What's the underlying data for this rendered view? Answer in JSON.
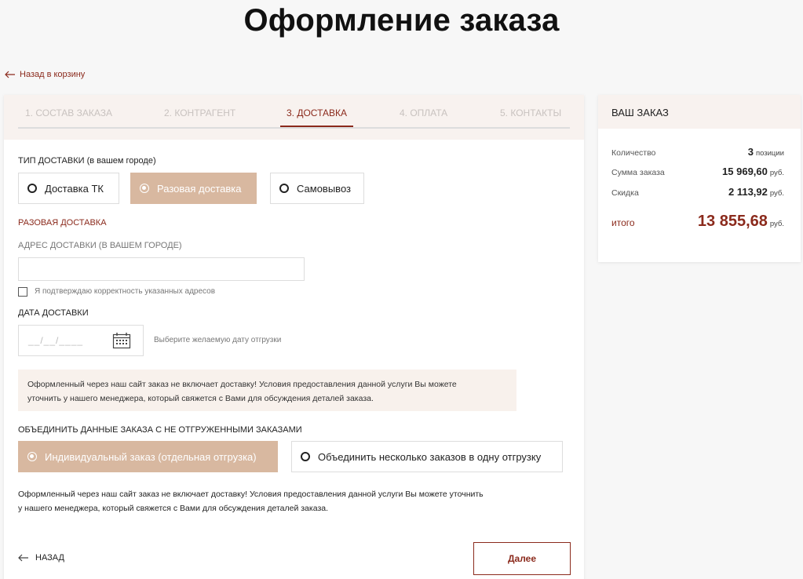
{
  "page": {
    "title": "Оформление заказа"
  },
  "nav": {
    "back_to_cart": "Назад в корзину"
  },
  "steps": [
    {
      "label": "1. СОСТАВ ЗАКАЗА"
    },
    {
      "label": "2. КОНТРАГЕНТ"
    },
    {
      "label": "3. ДОСТАВКА"
    },
    {
      "label": "4. ОПЛАТА"
    },
    {
      "label": "5. КОНТАКТЫ"
    }
  ],
  "active_step": "3. ДОСТАВКА",
  "delivery": {
    "type_label": "ТИП ДОСТАВКИ (в вашем городе)",
    "options": [
      {
        "label": "Доставка ТК",
        "selected": false
      },
      {
        "label": "Разовая доставка",
        "selected": true
      },
      {
        "label": "Самовывоз",
        "selected": false
      }
    ],
    "section_title": "РАЗОВАЯ ДОСТАВКА",
    "address_label": "АДРЕС ДОСТАВКИ (В ВАШЕМ ГОРОДЕ)",
    "address_value": "",
    "confirm_label": "Я подтверждаю корректность указанных адресов",
    "confirm_checked": false,
    "date_label": "ДАТА ДОСТАВКИ",
    "date_placeholder": "__/__/____",
    "date_hint": "Выберите желаемую дату отгрузки",
    "notice_line1": "Оформленный через наш сайт заказ не включает доставку! Условия предоставления данной услуги Вы можете",
    "notice_line2": "уточнить у нашего менеджера, который свяжется с Вами для обсуждения деталей заказа."
  },
  "merge": {
    "label": "ОБЪЕДИНИТЬ ДАННЫЕ ЗАКАЗА С НЕ ОТГРУЖЕННЫМИ ЗАКАЗАМИ",
    "options": [
      {
        "label": "Индивидуальный заказ (отдельная отгрузка)",
        "selected": true
      },
      {
        "label": "Объединить несколько заказов в одну отгрузку",
        "selected": false
      }
    ],
    "note_line1": "Оформленный через наш сайт заказ не включает доставку! Условия предоставления данной услуги Вы можете уточнить",
    "note_line2": "у нашего менеджера, который свяжется с Вами для обсуждения деталей заказа."
  },
  "footer": {
    "back_label": "НАЗАД",
    "next_label": "Далее"
  },
  "summary": {
    "title": "ВАШ ЗАКАЗ",
    "quantity_label": "Количество",
    "quantity_value": "3",
    "quantity_unit": "позиции",
    "sum_label": "Сумма заказа",
    "sum_value": "15 969,60",
    "discount_label": "Скидка",
    "discount_value": "2 113,92",
    "total_label": "итого",
    "total_value": "13 855,68",
    "currency": "руб."
  },
  "colors": {
    "accent": "#8b2a1c",
    "selected_option": "#d8b8a0",
    "panel_header": "#f8f2ef"
  },
  "icons": {
    "back_arrow": "arrow-left-icon",
    "calendar": "calendar-icon"
  }
}
